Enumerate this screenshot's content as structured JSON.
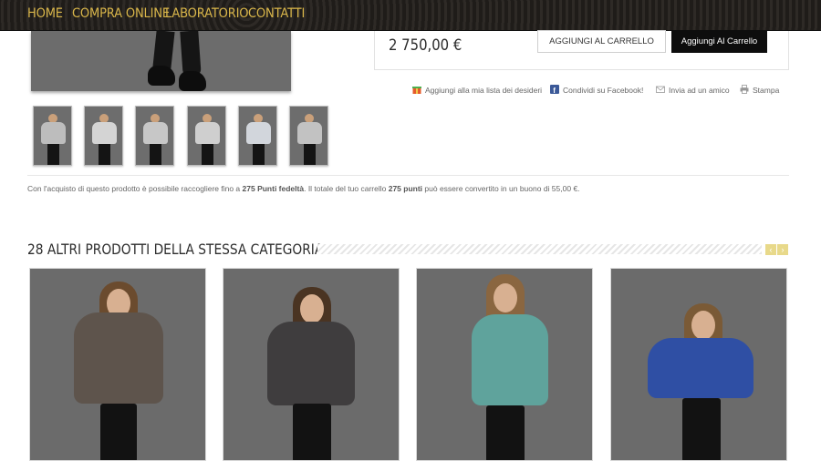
{
  "nav": {
    "items": [
      "HOME",
      "COMPRA ONLINE",
      "LABORATORIO",
      "CONTATTI"
    ]
  },
  "product": {
    "price": "2 750,00 €",
    "add_cart_outline": "AGGIUNGI AL CARRELLO",
    "add_cart_black": "Aggiungi Al Carrello"
  },
  "actions": {
    "wishlist": "Aggiungi alla mia lista dei desideri",
    "facebook": "Condividi su Facebook!",
    "friend": "Invia ad un amico",
    "print": "Stampa"
  },
  "thumbnails": {
    "coat_colors": [
      "#bdbdbd",
      "#d4d4d4",
      "#c7c7c7",
      "#cfcfcf",
      "#d2d6dc",
      "#c2c2c2"
    ]
  },
  "loyalty": {
    "pre": "Con l'acquisto di questo prodotto è possibile raccogliere fino a",
    "points_a": "275 Punti fedeltà",
    "mid": ". Il totale del tuo carrello",
    "points_b": "275 punti",
    "post": "può essere convertito in un buono di 55,00 €."
  },
  "related": {
    "title": "28 ALTRI PRODOTTI DELLA STESSA CATEGORIA:",
    "prev": "‹",
    "next": "›",
    "coat_colors": [
      "#5e544c",
      "#3f3d3e",
      "#5fa39c",
      "#2f4fa4"
    ]
  },
  "colors": {
    "nav_text": "#d9b64a",
    "nav_bg": "#262320",
    "accent_arrow": "#e8d98a"
  }
}
